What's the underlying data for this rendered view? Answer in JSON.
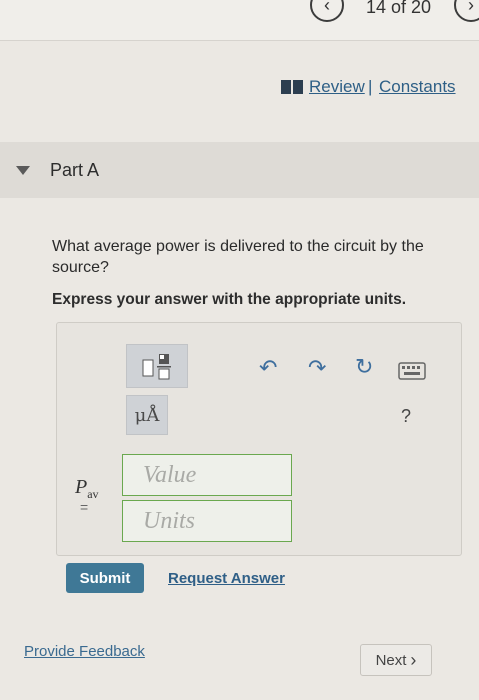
{
  "nav": {
    "prev_icon": "chevron-left-icon",
    "page_count": "14 of 20",
    "next_icon": "chevron-right-icon"
  },
  "links": {
    "review": "Review",
    "separator": "|",
    "constants": "Constants"
  },
  "part": {
    "title": "Part A",
    "question": "What average power is delivered to the circuit by the source?",
    "instruction": "Express your answer with the appropriate units."
  },
  "toolbar": {
    "template_icon": "fraction-template-icon",
    "units_label": "μÅ",
    "undo_icon": "undo-icon",
    "redo_icon": "redo-icon",
    "reset_icon": "reset-icon",
    "keyboard_icon": "keyboard-icon",
    "help_label": "?"
  },
  "answer": {
    "var_main": "P",
    "var_sub": "av",
    "equals": "=",
    "value_placeholder": "Value",
    "units_placeholder": "Units"
  },
  "actions": {
    "submit": "Submit",
    "request_answer": "Request Answer"
  },
  "footer": {
    "feedback": "Provide Feedback",
    "next": "Next",
    "next_arrow": "›"
  },
  "colors": {
    "link": "#2e5f86",
    "submit_bg": "#3f7896",
    "field_border": "#6aa84f",
    "icon_blue": "#3f6f9e"
  }
}
